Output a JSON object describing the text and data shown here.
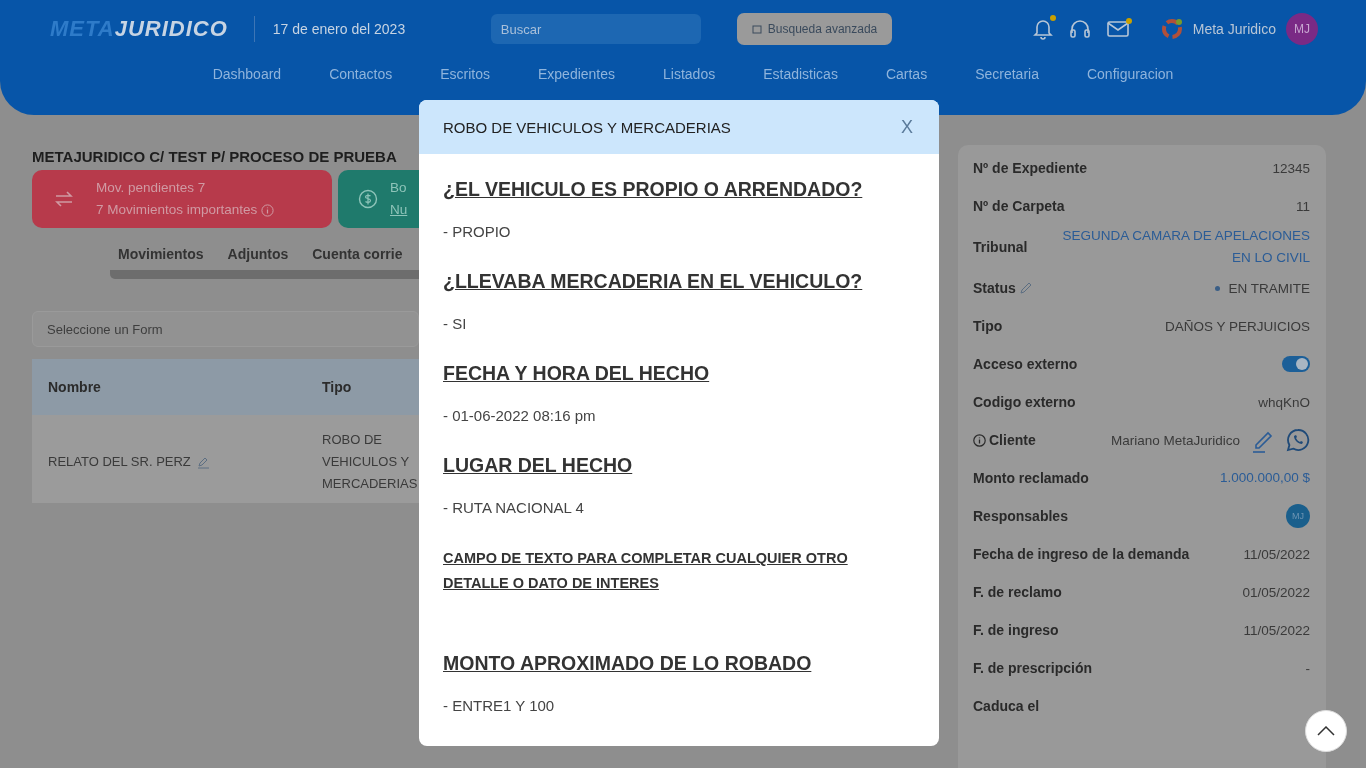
{
  "header": {
    "logo": {
      "part1": "META",
      "part2": "JURIDICO"
    },
    "date": "17 de enero del 2023",
    "search": {
      "placeholder": "Buscar"
    },
    "advanced_search": "Busqueda avanzada",
    "notifications": [
      {
        "kind": "bell",
        "badge": true
      },
      {
        "kind": "headset",
        "badge": false
      },
      {
        "kind": "mail",
        "badge": true
      }
    ],
    "user": {
      "name": "Meta Juridico",
      "initials": "MJ"
    }
  },
  "nav": [
    "Dashboard",
    "Contactos",
    "Escritos",
    "Expedientes",
    "Listados",
    "Estadisticas",
    "Cartas",
    "Secretaria",
    "Configuracion"
  ],
  "case_title": "METAJURIDICO C/ TEST P/ PROCESO DE PRUEBA",
  "alert_card": {
    "line1": "Mov. pendientes 7",
    "line2": "7 Movimientos importantes"
  },
  "balance_card": {
    "line1": "Bo",
    "line2": "Nu"
  },
  "tabs": [
    {
      "label": "Movimientos",
      "selected": false
    },
    {
      "label": "Adjuntos",
      "selected": false
    },
    {
      "label": "Cuenta corrie",
      "selected": false
    }
  ],
  "form_select": {
    "placeholder": "Seleccione un Form"
  },
  "table": {
    "columns": [
      "Nombre",
      "Tipo"
    ],
    "rows": [
      {
        "nombre": "RELATO DEL SR. PERZ",
        "tipo": "ROBO DE VEHICULOS Y MERCADERIAS"
      }
    ]
  },
  "details": [
    {
      "kind": "text",
      "label": "Nº de Expediente",
      "value": "12345"
    },
    {
      "kind": "text",
      "label": "Nº de Carpeta",
      "value": "11"
    },
    {
      "kind": "link",
      "label": "Tribunal",
      "value": "SEGUNDA CAMARA DE APELACIONES EN LO CIVIL"
    },
    {
      "kind": "status",
      "label": "Status",
      "value": "EN TRAMITE"
    },
    {
      "kind": "text",
      "label": "Tipo",
      "value": "DAÑOS Y PERJUICIOS"
    },
    {
      "kind": "toggle",
      "label": "Acceso externo",
      "on": true
    },
    {
      "kind": "text",
      "label": "Codigo externo",
      "value": "whqKnO"
    },
    {
      "kind": "client",
      "label": "Cliente",
      "value": "Mariano MetaJuridico"
    },
    {
      "kind": "link",
      "label": "Monto reclamado",
      "value": "1.000.000,00 $"
    },
    {
      "kind": "avatar",
      "label": "Responsables",
      "value": "MJ"
    },
    {
      "kind": "text",
      "label": "Fecha de ingreso de la demanda",
      "value": "11/05/2022"
    },
    {
      "kind": "text",
      "label": "F. de reclamo",
      "value": "01/05/2022"
    },
    {
      "kind": "text",
      "label": "F. de ingreso",
      "value": "11/05/2022"
    },
    {
      "kind": "text",
      "label": "F. de prescripción",
      "value": "-"
    },
    {
      "kind": "text",
      "label": "Caduca el"
    }
  ],
  "modal": {
    "title": "ROBO DE VEHICULOS Y MERCADERIAS",
    "close": "X",
    "sections": [
      {
        "kind": "large",
        "question": "¿EL VEHICULO ES PROPIO O ARRENDADO?",
        "answer": "- PROPIO"
      },
      {
        "kind": "large",
        "question": "¿LLEVABA MERCADERIA EN EL VEHICULO?",
        "answer": "- SI"
      },
      {
        "kind": "large",
        "question": "FECHA Y HORA DEL HECHO",
        "answer": "- 01-06-2022 08:16 pm"
      },
      {
        "kind": "large",
        "question": "LUGAR DEL HECHO",
        "answer": "- RUTA NACIONAL 4"
      },
      {
        "kind": "small",
        "question": "CAMPO DE TEXTO PARA COMPLETAR CUALQUIER OTRO DETALLE O DATO DE INTERES"
      },
      {
        "kind": "large",
        "question": "MONTO APROXIMADO DE LO ROBADO",
        "answer": "- ENTRE1 Y 100"
      }
    ]
  }
}
